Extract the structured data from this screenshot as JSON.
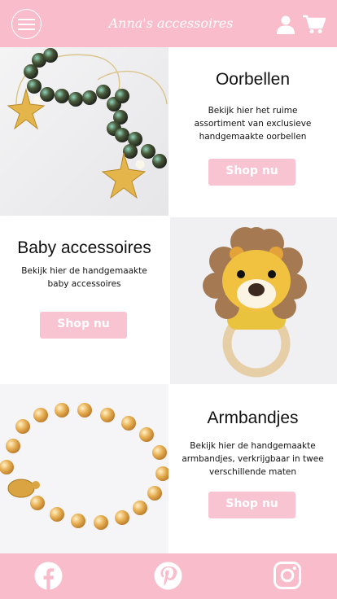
{
  "header": {
    "brand": "Anna's accessoires",
    "menu_icon": "hamburger-menu-icon",
    "user_icon": "user-icon",
    "cart_icon": "cart-icon",
    "color": "#f9bccb"
  },
  "categories": [
    {
      "title": "Oorbellen",
      "description": [
        "Bekijk hier het ruime",
        "assortiment van exclusieve",
        "handgemaakte oorbellen"
      ],
      "button": "Shop nu",
      "image": "earrings-photo"
    },
    {
      "title": "Baby accessoires",
      "description": [
        "Bekijk hier de handgemaakte",
        "baby accessoires"
      ],
      "button": "Shop nu",
      "image": "crochet-lion-rattle-photo"
    },
    {
      "title": "Armbandjes",
      "description": [
        "Bekijk hier de handgemaakte",
        "armbandjes, verkrijgbaar in twee",
        "verschillende maten"
      ],
      "button": "Shop nu",
      "image": "bracelet-photo"
    }
  ],
  "footer": {
    "social": [
      "facebook-icon",
      "pinterest-icon",
      "instagram-icon"
    ],
    "color": "#f9bccb"
  }
}
